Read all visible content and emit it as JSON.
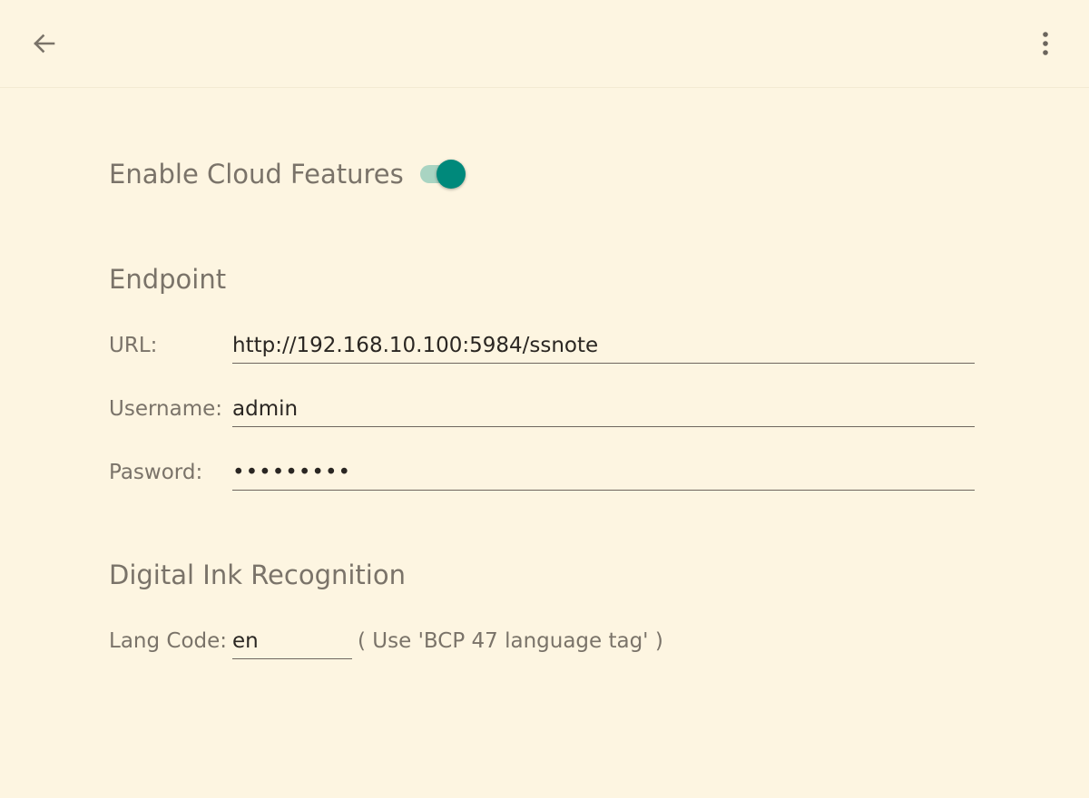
{
  "toolbar": {
    "back_icon": "arrow-back-icon",
    "menu_icon": "more-vert-icon"
  },
  "cloud": {
    "label": "Enable Cloud Features",
    "enabled": true,
    "accent": "#00897b",
    "track": "#a9d4c2"
  },
  "endpoint": {
    "title": "Endpoint",
    "url_label": "URL:",
    "url_value": "http://192.168.10.100:5984/ssnote",
    "username_label": "Username:",
    "username_value": "admin",
    "password_label": "Pasword:",
    "password_value": "•••••••••"
  },
  "ink": {
    "title": "Digital Ink Recognition",
    "lang_label": "Lang Code:",
    "lang_value": "en",
    "hint": "( Use 'BCP 47 language tag' )"
  },
  "colors": {
    "background": "#fdf5e1",
    "text": "#7a7369"
  }
}
